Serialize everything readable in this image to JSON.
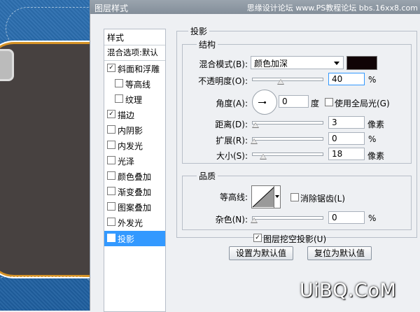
{
  "window": {
    "title": "图层样式",
    "watermark": "思缘设计论坛  www.PS教程论坛 bbs.16xx8.com"
  },
  "styles": {
    "header": "样式",
    "blend_options": "混合选项:默认",
    "items": [
      {
        "label": "斜面和浮雕",
        "checked": "✓",
        "indent": false
      },
      {
        "label": "等高线",
        "checked": "",
        "indent": true
      },
      {
        "label": "纹理",
        "checked": "",
        "indent": true
      },
      {
        "label": "描边",
        "checked": "✓",
        "indent": false
      },
      {
        "label": "内阴影",
        "checked": "",
        "indent": false
      },
      {
        "label": "内发光",
        "checked": "",
        "indent": false
      },
      {
        "label": "光泽",
        "checked": "",
        "indent": false
      },
      {
        "label": "颜色叠加",
        "checked": "",
        "indent": false
      },
      {
        "label": "渐变叠加",
        "checked": "",
        "indent": false
      },
      {
        "label": "图案叠加",
        "checked": "",
        "indent": false
      },
      {
        "label": "外发光",
        "checked": "",
        "indent": false
      },
      {
        "label": "投影",
        "checked": "✓",
        "indent": false
      }
    ]
  },
  "panel": {
    "title": "投影",
    "structure": {
      "legend": "结构",
      "blend_mode_label": "混合模式(B):",
      "blend_mode_value": "颜色加深",
      "shadow_color": "#100406",
      "opacity_label": "不透明度(O):",
      "opacity_value": "40",
      "percent": "%",
      "angle_label": "角度(A):",
      "angle_value": "0",
      "degree": "度",
      "global_light_label": "使用全局光(G)",
      "global_light_checked": "",
      "distance_label": "距离(D):",
      "distance_value": "3",
      "pixels": "像素",
      "spread_label": "扩展(R):",
      "spread_value": "0",
      "size_label": "大小(S):",
      "size_value": "18"
    },
    "quality": {
      "legend": "品质",
      "contour_label": "等高线:",
      "antialias_label": "消除锯齿(L)",
      "antialias_checked": "",
      "noise_label": "杂色(N):",
      "noise_value": "0",
      "percent": "%"
    },
    "knockout_label": "图层挖空投影(U)",
    "knockout_checked": "✓",
    "make_default": "设置为默认值",
    "reset_default": "复位为默认值"
  },
  "brand_text": "UiBQ.CoM"
}
